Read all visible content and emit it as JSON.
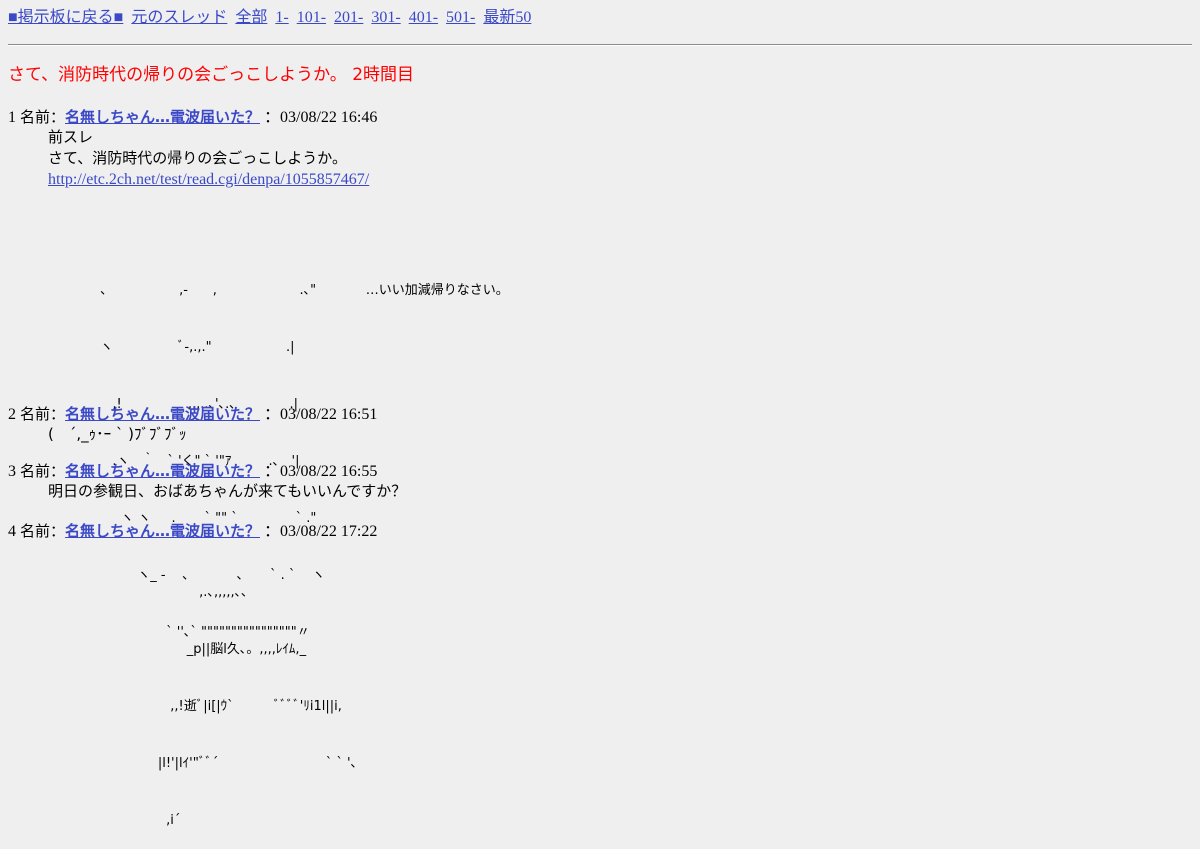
{
  "nav": {
    "back_board": "■掲示板に戻る■",
    "origin_thread": "元のスレッド",
    "all": "全部",
    "range_1": "1-",
    "range_101": "101-",
    "range_201": "201-",
    "range_301": "301-",
    "range_401": "401-",
    "range_501": "501-",
    "latest50": "最新50"
  },
  "thread": {
    "title": "さて、消防時代の帰りの会ごっこしようか。 2時間目"
  },
  "colors": {
    "background": "#efefef",
    "title_red": "#ff0000",
    "link_blue": "#3b49c7"
  },
  "posts": [
    {
      "number": "1",
      "name_label": "名前：",
      "name": "名無しちゃん…電波届いた？",
      "date": "：03/08/22 16:46",
      "lines": [
        "前スレ",
        "さて、消防時代の帰りの会ごっこしようか。"
      ],
      "url": "http://etc.2ch.net/test/read.cgi/denpa/1055857467/",
      "aa": [
        "、                ,-      ,                    .､\"            …いい加減帰りなさい。",
        "ヽ                ﾞ-,.,.\"                  .|",
        "   ,!                ,,,..､'､.､             .|",
        "   .ヽ   ｀   ` 'く\" ` '\"ｱ         .､   '|",
        "     ヽ ヽ     .       ` \"\" `              ` .\"",
        "         ヽ_ -    、          、     ` . `    ヽ",
        "                ` ''､` \"\"\"\"\"\"\"\"\"\"\"\"\"\"\"\"〃"
      ]
    },
    {
      "number": "2",
      "name_label": "名前：",
      "name": "名無しちゃん…電波届いた？",
      "date": "：03/08/22 16:51",
      "lines": [
        "(　´,_ｩ･ｰ ` )ﾌﾞﾌﾞﾌﾞｯ"
      ]
    },
    {
      "number": "3",
      "name_label": "名前：",
      "name": "名無しちゃん…電波届いた？",
      "date": "：03/08/22 16:55",
      "lines": [
        "明日の参観日、おばあちゃんが来てもいいんですか？"
      ]
    },
    {
      "number": "4",
      "name_label": "名前：",
      "name": "名無しちゃん…電波届いた？",
      "date": "：03/08/22 17:22",
      "aa": [
        "                        ,.､,,,,,､､",
        "                     _p||脳l久､。,,,,ﾚｲﾑ,_",
        "                 ,,!逝ﾞ|i[|ｳ`          ﾞﾞﾞﾞ'ﾘi1l||i,",
        "              |l!'|lｲ'\"ﾞﾞ´                          ` ` '､",
        "                ,i´"
      ]
    }
  ]
}
